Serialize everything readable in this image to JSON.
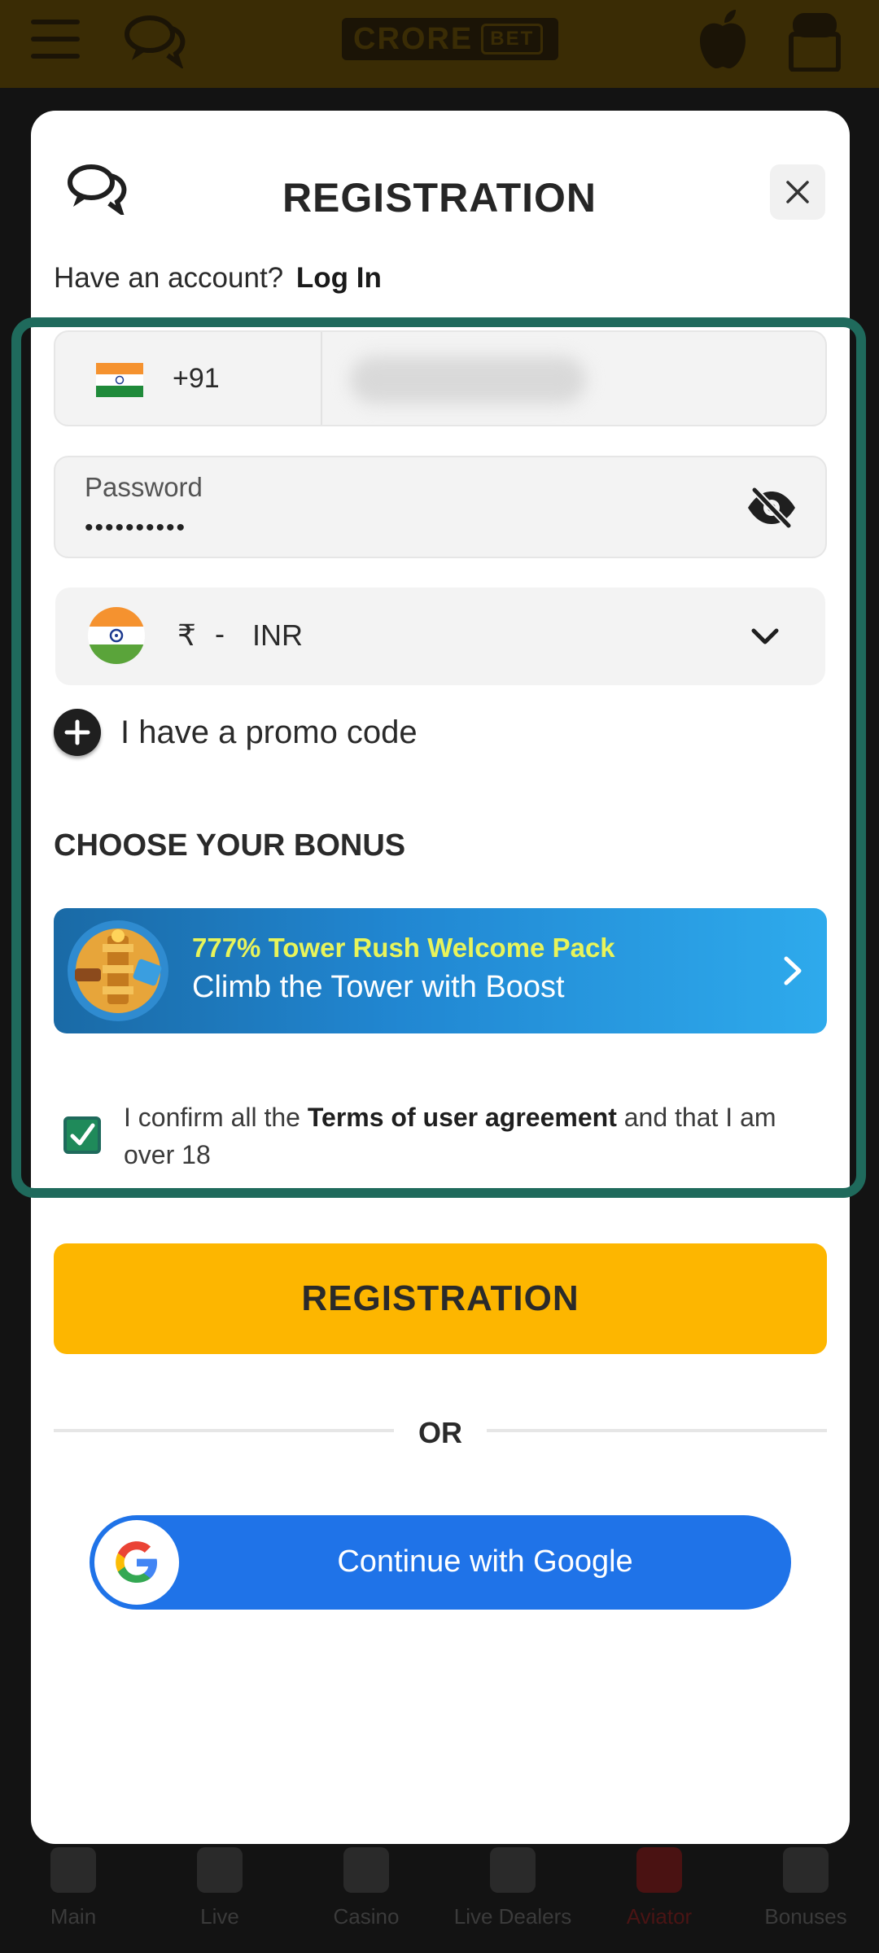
{
  "app": {
    "logo_text": "CRORE",
    "logo_tag": "BET",
    "colors": {
      "accent": "#fdb600",
      "highlight_frame": "#1f6a5c",
      "bonus_title": "#e8f45a",
      "google_blue": "#1f73e8"
    }
  },
  "header_icons": [
    "menu-icon",
    "chat-icon",
    "apple-icon",
    "android-icon"
  ],
  "modal": {
    "title": "REGISTRATION",
    "close_icon": "close-icon",
    "account_prompt": "Have an account?",
    "login_link": "Log In"
  },
  "phone": {
    "dial_code": "+91",
    "value": ""
  },
  "password": {
    "label": "Password",
    "value": "••••••••••"
  },
  "currency": {
    "symbol": "₹",
    "separator": "-",
    "code": "INR"
  },
  "promo": {
    "label": "I have a promo code"
  },
  "bonus": {
    "heading": "CHOOSE YOUR BONUS",
    "card_title": "777% Tower Rush Welcome Pack",
    "card_subtitle": "Climb the Tower with Boost"
  },
  "terms": {
    "checked": true,
    "prefix": "I confirm all the ",
    "link": "Terms of user agreement",
    "suffix": " and that I am over 18"
  },
  "register_button": "REGISTRATION",
  "or_text": "OR",
  "google_button": "Continue with Google",
  "bottom_nav": {
    "items": [
      {
        "label": "Main",
        "icon": "grid-icon"
      },
      {
        "label": "Live",
        "icon": "live-icon"
      },
      {
        "label": "Casino",
        "icon": "casino-icon"
      },
      {
        "label": "Live Dealers",
        "icon": "dealer-icon"
      },
      {
        "label": "Aviator",
        "icon": "plane-icon",
        "active": true
      },
      {
        "label": "Bonuses",
        "icon": "gift-icon"
      }
    ]
  }
}
